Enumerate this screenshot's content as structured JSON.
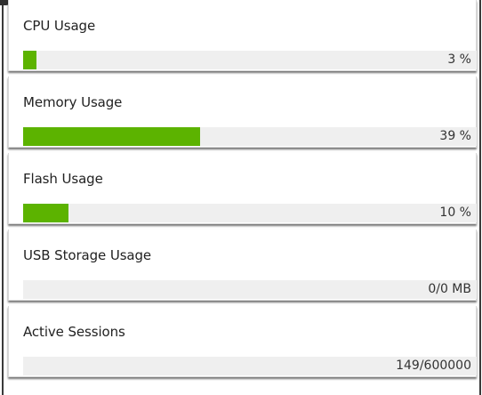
{
  "panels": [
    {
      "title": "CPU Usage",
      "value_text": "3 %",
      "percent": 3,
      "accent": "#5cb300"
    },
    {
      "title": "Memory Usage",
      "value_text": "39 %",
      "percent": 39,
      "accent": "#5cb300"
    },
    {
      "title": "Flash Usage",
      "value_text": "10 %",
      "percent": 10,
      "accent": "#5cb300"
    },
    {
      "title": "USB Storage Usage",
      "value_text": "0/0 MB",
      "percent": 0,
      "accent": "#5cb300"
    },
    {
      "title": "Active Sessions",
      "value_text": "149/600000",
      "percent": 0,
      "accent": "#5cb300"
    }
  ]
}
